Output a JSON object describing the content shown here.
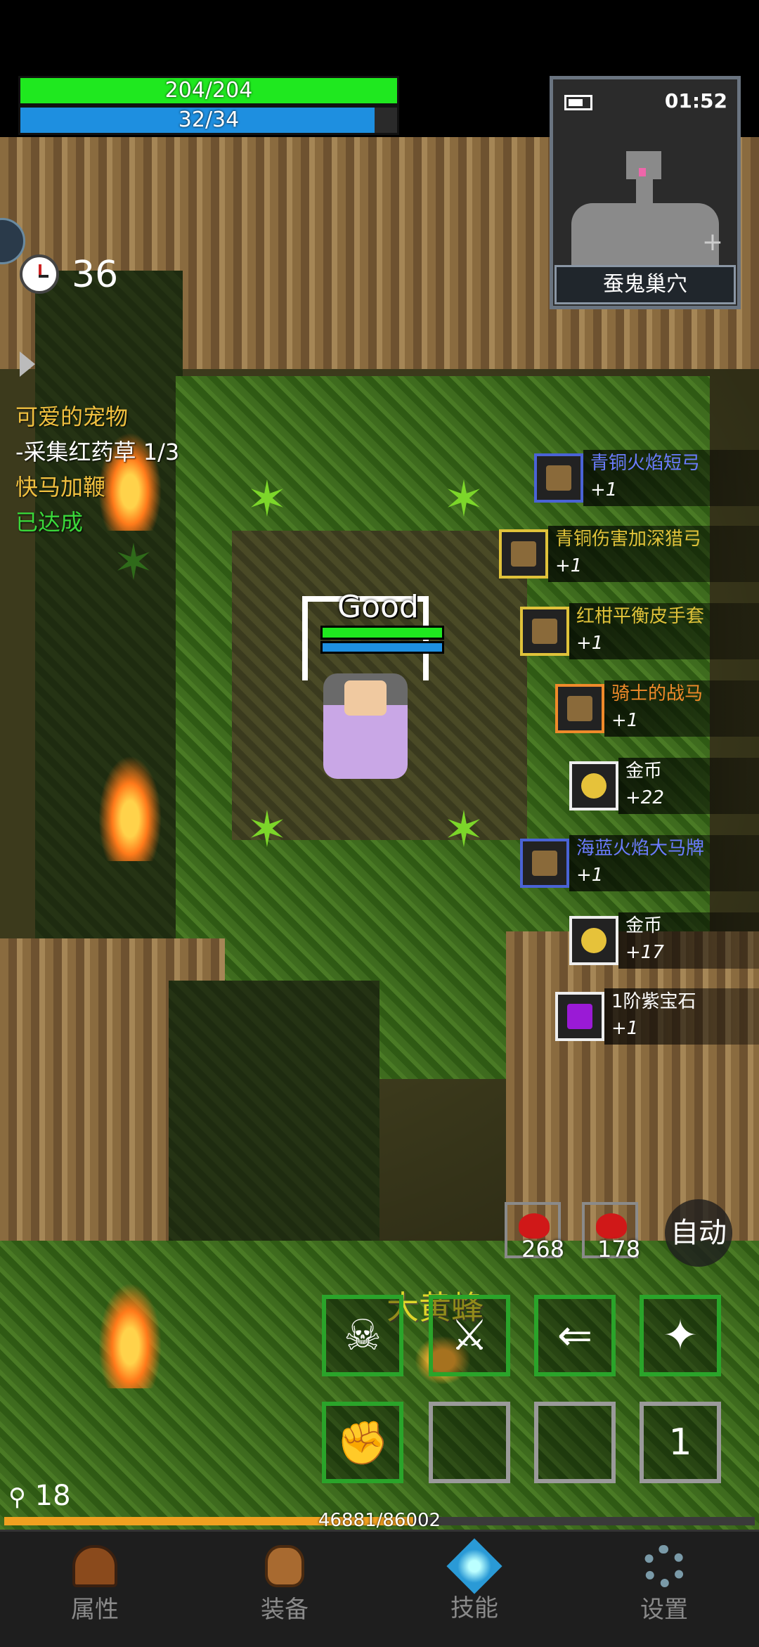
{
  "hud": {
    "hp_text": "204/204",
    "hp_fraction": 1.0,
    "mp_text": "32/34",
    "mp_fraction": 0.94,
    "timer_value": "36"
  },
  "minimap": {
    "time": "01:52",
    "location": "蚕鬼巢穴"
  },
  "quests": [
    {
      "text": "可爱的宠物",
      "color": "#f0c040"
    },
    {
      "text": "-采集红药草 1/3",
      "color": "#ffffff"
    },
    {
      "text": "快马加鞭",
      "color": "#f0c040"
    },
    {
      "text": "已达成",
      "color": "#3ad83a"
    }
  ],
  "player": {
    "combat_text": "Good"
  },
  "loot": [
    {
      "name": "青铜火焰短弓",
      "count": "+1",
      "color": "#6b7cff",
      "icon": "bow-icon",
      "border": "#4a63d6"
    },
    {
      "name": "青铜伤害加深猎弓",
      "count": "+1",
      "color": "#e0c23a",
      "icon": "hunting-bow-icon",
      "border": "#e0c23a"
    },
    {
      "name": "红柑平衡皮手套",
      "count": "+1",
      "color": "#e0c23a",
      "icon": "glove-icon",
      "border": "#e0c23a"
    },
    {
      "name": "骑士的战马",
      "count": "+1",
      "color": "#f08a2a",
      "icon": "warhorse-icon",
      "border": "#f08a2a"
    },
    {
      "name": "金币",
      "count": "+22",
      "color": "#ffffff",
      "icon": "gold-coin-icon",
      "border": "#eeeeee"
    },
    {
      "name": "海蓝火焰大马牌",
      "count": "+1",
      "color": "#6b7cff",
      "icon": "horse-token-icon",
      "border": "#4a63d6"
    },
    {
      "name": "金币",
      "count": "+17",
      "color": "#ffffff",
      "icon": "gold-coin-icon",
      "border": "#eeeeee"
    },
    {
      "name": "1阶紫宝石",
      "count": "+1",
      "color": "#ffffff",
      "icon": "purple-gem-icon",
      "border": "#eeeeee"
    }
  ],
  "potions": {
    "hp_potion_count": "268",
    "mp_potion_count": "178",
    "auto_label": "自动"
  },
  "enemy_label": "大黄蜂",
  "skills": {
    "slot8_count": "1"
  },
  "level": {
    "value": "18",
    "exp_text": "46881/86002",
    "exp_fraction": 0.545
  },
  "nav": {
    "attributes": "属性",
    "equipment": "装备",
    "skills": "技能",
    "settings": "设置"
  },
  "colors": {
    "hp": "#1fe81f",
    "mp": "#1e8fe0",
    "exp": "#f0a020",
    "skill_border": "#2aa42a"
  }
}
